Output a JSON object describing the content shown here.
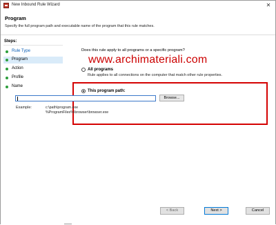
{
  "window": {
    "title": "New Inbound Rule Wizard",
    "close_glyph": "✕"
  },
  "header": {
    "title": "Program",
    "subtitle": "Specify the full program path and executable name of the program that this rule matches."
  },
  "steps": {
    "title": "Steps:",
    "items": [
      {
        "label": "Rule Type"
      },
      {
        "label": "Program"
      },
      {
        "label": "Action"
      },
      {
        "label": "Profile"
      },
      {
        "label": "Name"
      }
    ]
  },
  "main": {
    "question": "Does this rule apply to all programs or a specific program?",
    "watermark": "www.archimateriali.com",
    "options": [
      {
        "label": "All programs",
        "description": "Rule applies to all connections on the computer that match other rule properties."
      },
      {
        "label": "This program path:"
      }
    ],
    "path_value": "",
    "browse_label": "Browse...",
    "example_label": "Example:",
    "example_lines": [
      "c:\\path\\program.exe",
      "%ProgramFiles%\\browser\\browser.exe"
    ]
  },
  "footer": {
    "back_label": "< Back",
    "next_label": "Next >",
    "cancel_label": "Cancel"
  },
  "colors": {
    "accent": "#0078d7",
    "highlight_box": "#d40000",
    "selected_step": "#d9ebf9",
    "watermark": "#cc0000"
  }
}
